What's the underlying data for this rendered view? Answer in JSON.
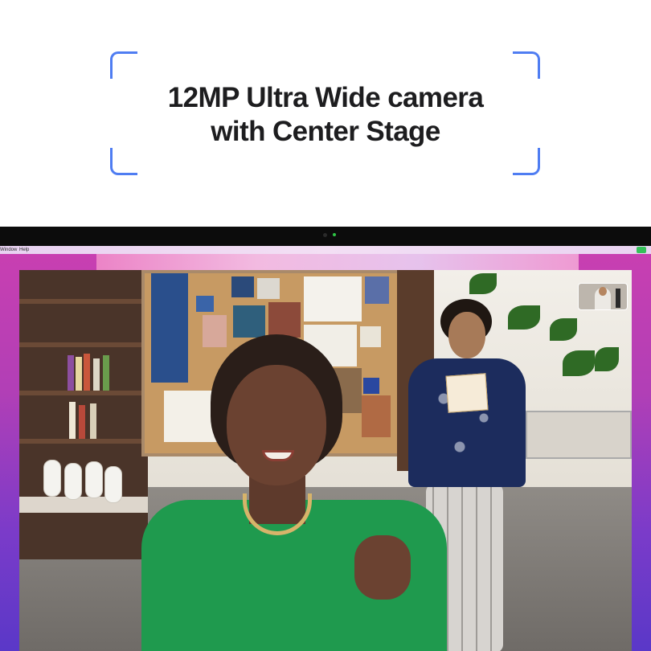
{
  "headline": {
    "line1": "12MP Ultra Wide camera",
    "line2": "with Center Stage"
  },
  "menubar": {
    "items": [
      "Window",
      "Help"
    ]
  },
  "colors": {
    "frame_accent": "#4f7df2",
    "headline_text": "#1d1d1f",
    "camera_led": "#2ec445"
  },
  "icons": [
    "camera-dot-icon",
    "camera-led-icon",
    "status-menu-icon"
  ]
}
